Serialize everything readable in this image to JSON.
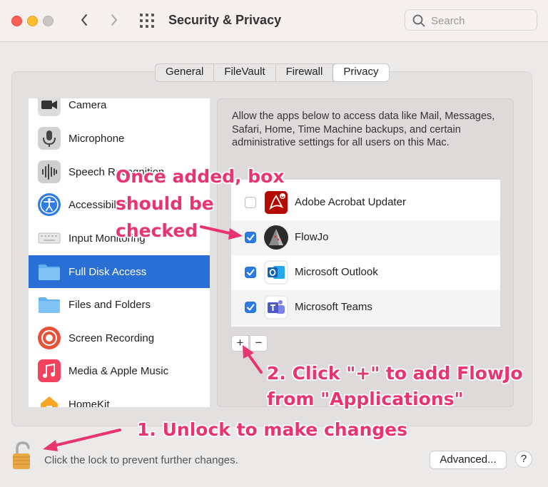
{
  "window": {
    "title": "Security & Privacy",
    "search_placeholder": "Search"
  },
  "tabs": [
    {
      "label": "General",
      "active": false
    },
    {
      "label": "FileVault",
      "active": false
    },
    {
      "label": "Firewall",
      "active": false
    },
    {
      "label": "Privacy",
      "active": true
    }
  ],
  "sidebar": {
    "items": [
      {
        "label": "Camera",
        "icon": "camera-icon",
        "selected": false
      },
      {
        "label": "Microphone",
        "icon": "microphone-icon",
        "selected": false
      },
      {
        "label": "Speech Recognition",
        "icon": "waveform-icon",
        "selected": false
      },
      {
        "label": "Accessibility",
        "icon": "accessibility-icon",
        "selected": false
      },
      {
        "label": "Input Monitoring",
        "icon": "keyboard-icon",
        "selected": false
      },
      {
        "label": "Full Disk Access",
        "icon": "folder-icon",
        "selected": true
      },
      {
        "label": "Files and Folders",
        "icon": "folder-icon",
        "selected": false
      },
      {
        "label": "Screen Recording",
        "icon": "record-icon",
        "selected": false
      },
      {
        "label": "Media & Apple Music",
        "icon": "music-icon",
        "selected": false
      },
      {
        "label": "HomeKit",
        "icon": "home-icon",
        "selected": false
      }
    ]
  },
  "main": {
    "description": "Allow the apps below to access data like Mail, Messages, Safari, Home, Time Machine backups, and certain administrative settings for all users on this Mac.",
    "apps": [
      {
        "name": "Adobe Acrobat Updater",
        "checked": false,
        "icon": "acrobat-icon"
      },
      {
        "name": "FlowJo",
        "checked": true,
        "icon": "flowjo-icon"
      },
      {
        "name": "Microsoft Outlook",
        "checked": true,
        "icon": "outlook-icon"
      },
      {
        "name": "Microsoft Teams",
        "checked": true,
        "icon": "teams-icon"
      }
    ],
    "add_label": "+",
    "remove_label": "−"
  },
  "footer": {
    "lock_text": "Click the lock to prevent further changes.",
    "advanced_label": "Advanced...",
    "help_label": "?"
  },
  "annotations": {
    "checked_note": [
      "Once added, box",
      "should be",
      "checked"
    ],
    "add_note": [
      "2. Click \"+\" to add FlowJo",
      "from \"Applications\""
    ],
    "unlock_note": "1. Unlock to make changes"
  },
  "colors": {
    "selection": "#2a6fd6",
    "checkbox": "#2a7be2",
    "annotation": "#e8346f"
  }
}
